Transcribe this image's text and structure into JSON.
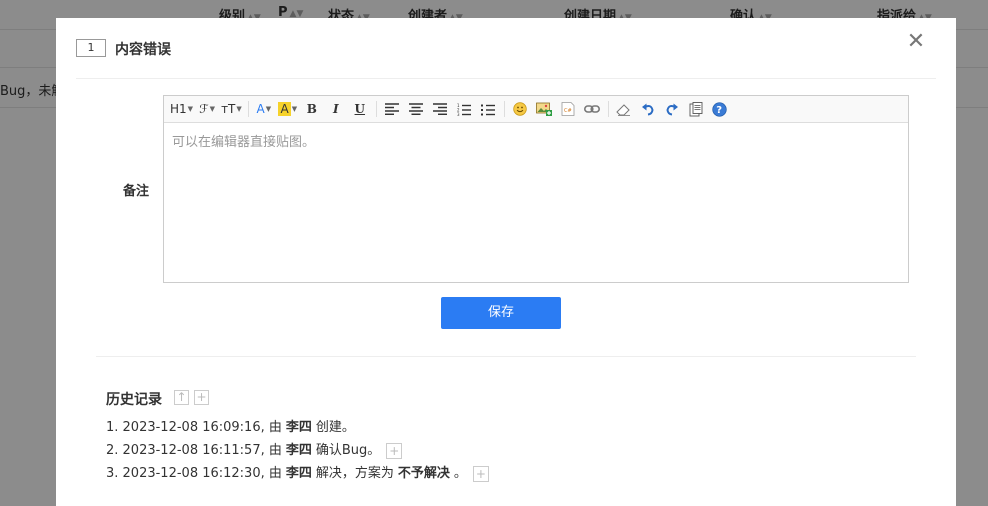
{
  "background": {
    "columns": [
      "级别",
      "P",
      "状态",
      "创建者",
      "创建日期",
      "确认",
      "指派给"
    ],
    "row_snippet": "Bug，未解"
  },
  "modal": {
    "id": "1",
    "title": "内容错误",
    "close_glyph": "✕",
    "remark_label": "备注",
    "editor": {
      "placeholder": "可以在编辑器直接贴图。",
      "toolbar": {
        "heading": "H1",
        "font": "ℱ",
        "size": "ᴛT",
        "font_color": "A",
        "bg_color": "A",
        "bold": "B",
        "italic": "I",
        "underline": "U"
      }
    },
    "save_label": "保存",
    "history": {
      "title": "历史记录",
      "items": [
        {
          "prefix": "1. 2023-12-08 16:09:16, 由",
          "user": "李四",
          "action": "创建。"
        },
        {
          "prefix": "2. 2023-12-08 16:11:57, 由",
          "user": "李四",
          "action": "确认Bug。"
        },
        {
          "prefix": "3. 2023-12-08 16:12:30, 由",
          "user": "李四",
          "action": "解决，方案为",
          "resolution": "不予解决",
          "suffix": "。"
        }
      ]
    }
  }
}
